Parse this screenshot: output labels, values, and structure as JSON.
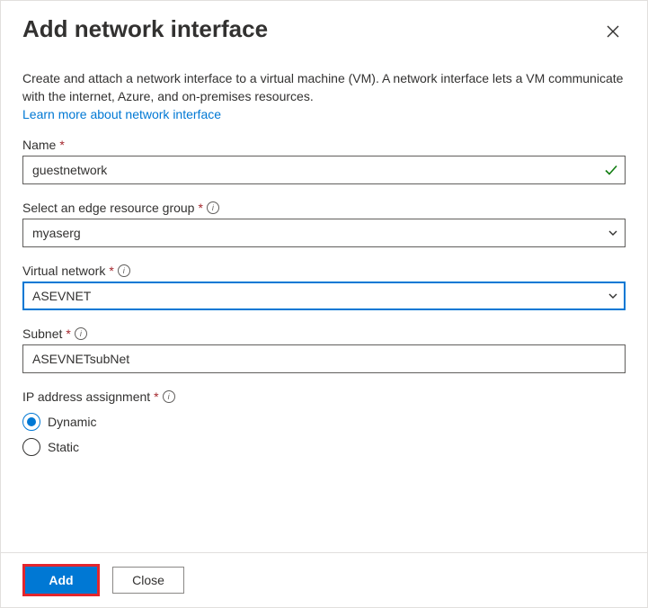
{
  "header": {
    "title": "Add network interface"
  },
  "description": "Create and attach a network interface to a virtual machine (VM). A network interface lets a VM communicate with the internet, Azure, and on-premises resources.",
  "learnMore": "Learn more about network interface",
  "fields": {
    "name": {
      "label": "Name",
      "value": "guestnetwork"
    },
    "resourceGroup": {
      "label": "Select an edge resource group",
      "value": "myaserg"
    },
    "virtualNetwork": {
      "label": "Virtual network",
      "value": "ASEVNET"
    },
    "subnet": {
      "label": "Subnet",
      "value": "ASEVNETsubNet"
    },
    "ipAssignment": {
      "label": "IP address assignment",
      "options": {
        "dynamic": "Dynamic",
        "static": "Static"
      },
      "selected": "dynamic"
    }
  },
  "footer": {
    "add": "Add",
    "close": "Close"
  },
  "requiredMark": "*"
}
